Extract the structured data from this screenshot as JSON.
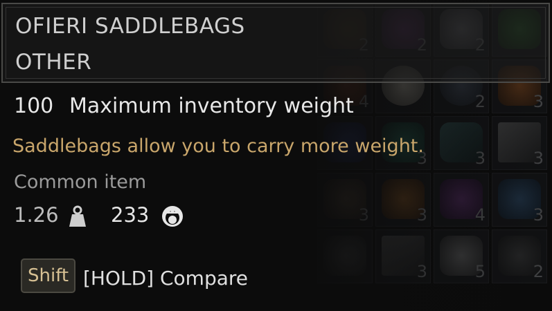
{
  "tooltip": {
    "item_name": "OFIERI SADDLEBAGS",
    "item_category": "OTHER",
    "stat_value": "100",
    "stat_label": "Maximum inventory weight",
    "description": "Saddlebags allow you to carry more weight.",
    "rarity": "Common item",
    "weight": "1.26",
    "weight_icon": "weight-icon",
    "price": "233",
    "price_icon": "crown-coin-icon",
    "compare_key": "Shift",
    "compare_text": "[HOLD] Compare"
  },
  "inventory_grid": {
    "counts": [
      "2",
      "2",
      "2",
      "",
      "4",
      "",
      "2",
      "3",
      "",
      "3",
      "3",
      "3",
      "3",
      "3",
      "4",
      "3",
      "",
      "3",
      "5",
      "2"
    ]
  },
  "colors": {
    "description": "#c9a66b",
    "rarity": "#9b9b9b",
    "panel_border": "#4a4a48"
  }
}
